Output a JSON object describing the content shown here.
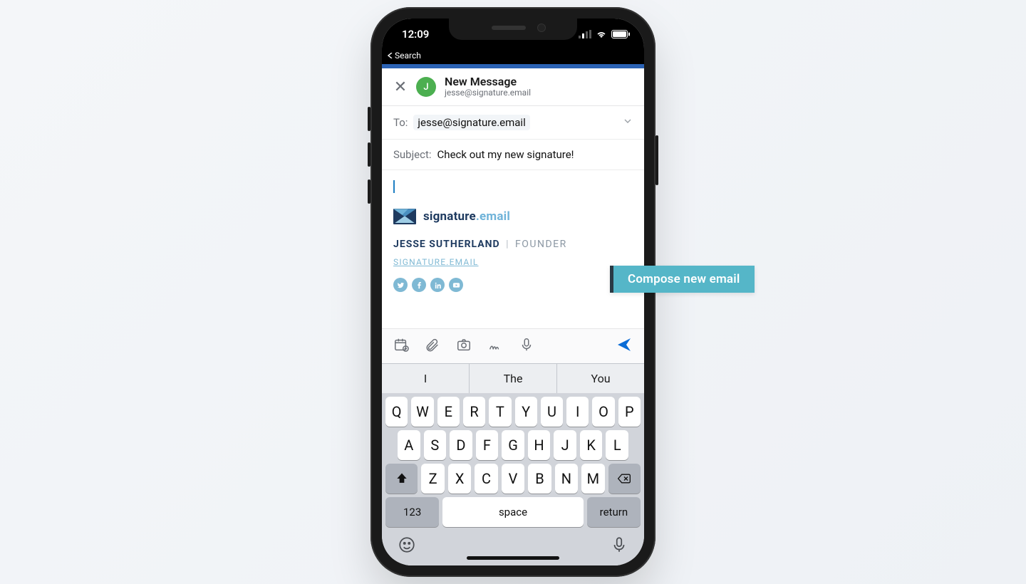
{
  "status": {
    "time": "12:09",
    "back_label": "Search"
  },
  "header": {
    "avatar_initial": "J",
    "title": "New Message",
    "subtitle": "jesse@signature.email"
  },
  "fields": {
    "to_label": "To:",
    "to_value": "jesse@signature.email",
    "subject_label": "Subject:",
    "subject_value": "Check out my new signature!"
  },
  "signature": {
    "brand_a": "signature",
    "brand_b": ".email",
    "name": "JESSE SUTHERLAND",
    "separator": "|",
    "role": "FOUNDER",
    "link": "SIGNATURE.EMAIL"
  },
  "keyboard": {
    "suggestions": [
      "I",
      "The",
      "You"
    ],
    "row1": [
      "Q",
      "W",
      "E",
      "R",
      "T",
      "Y",
      "U",
      "I",
      "O",
      "P"
    ],
    "row2": [
      "A",
      "S",
      "D",
      "F",
      "G",
      "H",
      "J",
      "K",
      "L"
    ],
    "row3": [
      "Z",
      "X",
      "C",
      "V",
      "B",
      "N",
      "M"
    ],
    "num_key": "123",
    "space_key": "space",
    "return_key": "return"
  },
  "callout": {
    "label": "Compose new email"
  }
}
